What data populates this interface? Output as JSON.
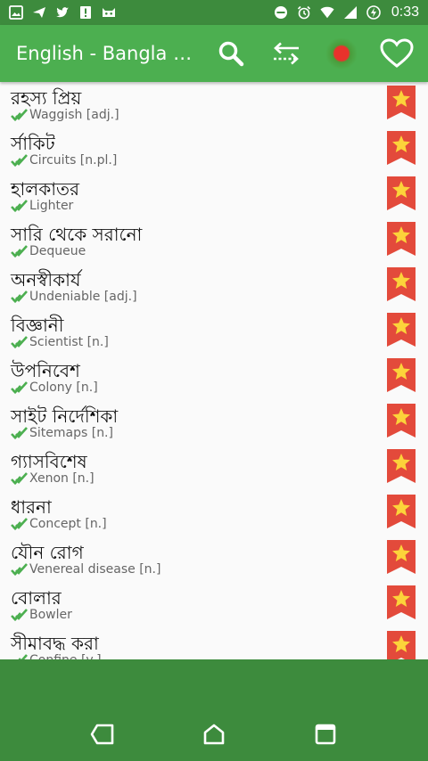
{
  "status_bar": {
    "time": "0:33",
    "left_icons": [
      "image-icon",
      "send-icon",
      "twitter-icon",
      "alert-icon",
      "cat-icon"
    ],
    "right_icons": [
      "do-not-disturb-icon",
      "alarm-icon",
      "wifi-icon",
      "signal-icon",
      "battery-charging-icon"
    ]
  },
  "app_bar": {
    "title": "English - Bangla O...",
    "actions": [
      "search-icon",
      "swap-arrows-icon",
      "bangladesh-flag-icon",
      "favorite-heart-icon"
    ]
  },
  "colors": {
    "status_bar": "#3d8b3d",
    "app_bar": "#4caf50",
    "bookmark": "#e34a3b",
    "star": "#fcd33a",
    "check": "#4caf50",
    "nav_background": "#3d8b3d"
  },
  "words": [
    {
      "bn": "রহস্য প্রিয়",
      "en": "Waggish [adj.]"
    },
    {
      "bn": "র্সাকিট",
      "en": "Circuits [n.pl.]"
    },
    {
      "bn": "হালকাতর",
      "en": "Lighter"
    },
    {
      "bn": "সারি থেকে সরানো",
      "en": "Dequeue"
    },
    {
      "bn": "অনস্বীকার্য",
      "en": "Undeniable [adj.]"
    },
    {
      "bn": "বিজ্ঞানী",
      "en": "Scientist [n.]"
    },
    {
      "bn": "উপনিবেশ",
      "en": "Colony [n.]"
    },
    {
      "bn": "সাইট নির্দেশিকা",
      "en": "Sitemaps [n.]"
    },
    {
      "bn": "গ্যাসবিশেষ",
      "en": "Xenon [n.]"
    },
    {
      "bn": "ধারনা",
      "en": "Concept [n.]"
    },
    {
      "bn": "যৌন রোগ",
      "en": "Venereal disease [n.]"
    },
    {
      "bn": "বোলার",
      "en": "Bowler"
    },
    {
      "bn": "সীমাবদ্ধ করা",
      "en": "Confine [v.]"
    }
  ],
  "nav_bar": [
    "back-icon",
    "home-icon",
    "recents-icon"
  ]
}
